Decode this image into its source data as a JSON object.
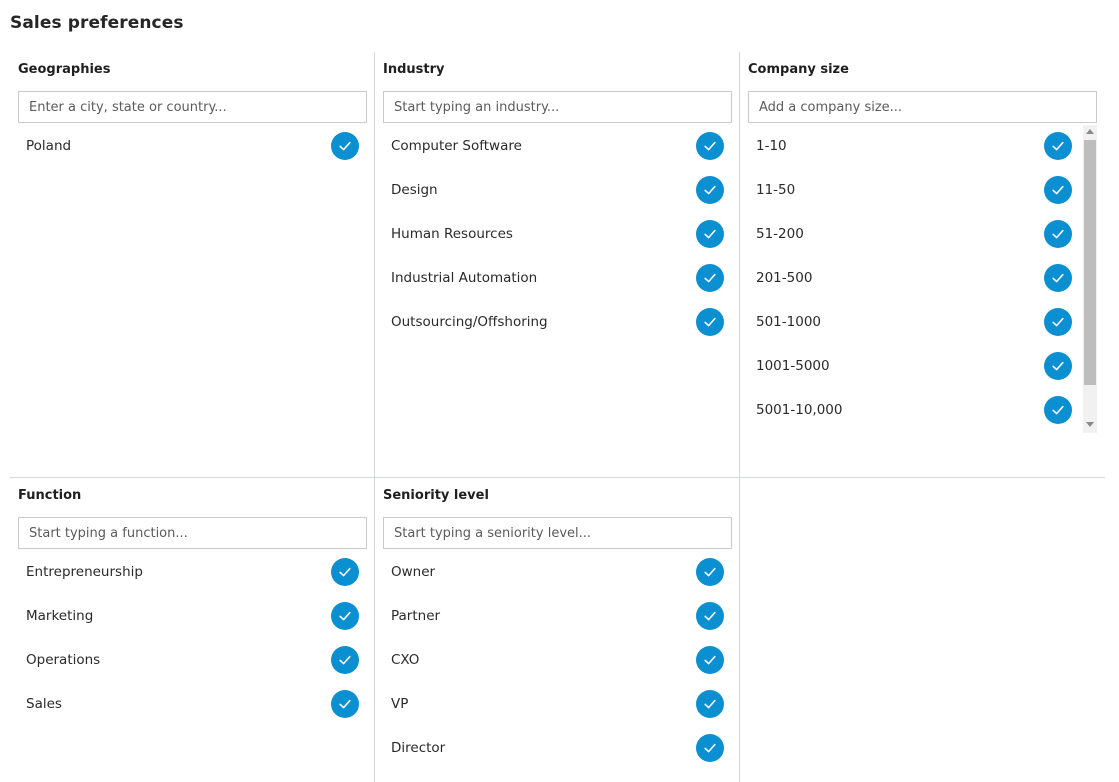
{
  "page": {
    "title": "Sales preferences"
  },
  "colors": {
    "accent": "#0a8fd1",
    "divider": "#d3d6da"
  },
  "panels": {
    "geographies": {
      "title": "Geographies",
      "placeholder": "Enter a city, state or country...",
      "items": [
        {
          "label": "Poland",
          "selected": true
        }
      ]
    },
    "industry": {
      "title": "Industry",
      "placeholder": "Start typing an industry...",
      "items": [
        {
          "label": "Computer Software",
          "selected": true
        },
        {
          "label": "Design",
          "selected": true
        },
        {
          "label": "Human Resources",
          "selected": true
        },
        {
          "label": "Industrial Automation",
          "selected": true
        },
        {
          "label": "Outsourcing/Offshoring",
          "selected": true
        }
      ]
    },
    "company_size": {
      "title": "Company size",
      "placeholder": "Add a company size...",
      "items": [
        {
          "label": "1-10",
          "selected": true
        },
        {
          "label": "11-50",
          "selected": true
        },
        {
          "label": "51-200",
          "selected": true
        },
        {
          "label": "201-500",
          "selected": true
        },
        {
          "label": "501-1000",
          "selected": true
        },
        {
          "label": "1001-5000",
          "selected": true
        },
        {
          "label": "5001-10,000",
          "selected": true
        }
      ]
    },
    "function": {
      "title": "Function",
      "placeholder": "Start typing a function...",
      "items": [
        {
          "label": "Entrepreneurship",
          "selected": true
        },
        {
          "label": "Marketing",
          "selected": true
        },
        {
          "label": "Operations",
          "selected": true
        },
        {
          "label": "Sales",
          "selected": true
        }
      ]
    },
    "seniority": {
      "title": "Seniority level",
      "placeholder": "Start typing a seniority level...",
      "items": [
        {
          "label": "Owner",
          "selected": true
        },
        {
          "label": "Partner",
          "selected": true
        },
        {
          "label": "CXO",
          "selected": true
        },
        {
          "label": "VP",
          "selected": true
        },
        {
          "label": "Director",
          "selected": true
        }
      ]
    }
  }
}
